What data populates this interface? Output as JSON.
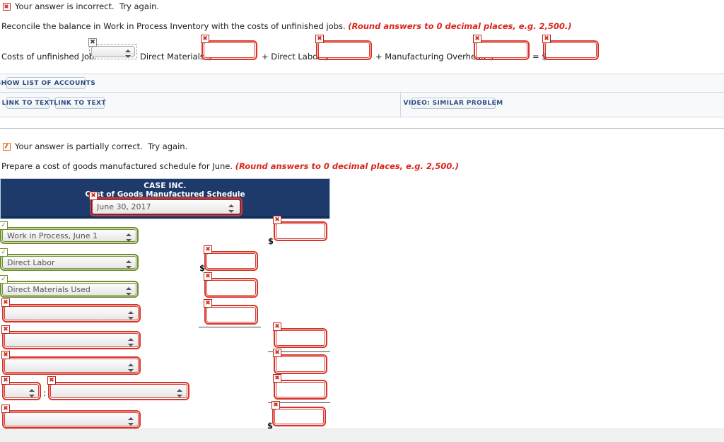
{
  "part1": {
    "status": {
      "icon": "error-x-icon",
      "text": "Your answer is incorrect.  Try again."
    },
    "prompt_main": "Reconcile the balance in Work in Process Inventory with the costs of unfinished jobs. ",
    "prompt_hint": "(Round answers to 0 decimal places, e.g. 2,500.)",
    "label_job": "Costs of unfinished Job:",
    "job_select_value": "",
    "label_dm": "Direct Materials $",
    "label_dl": "+ Direct Labor $",
    "label_moh": "+ Manufacturing Overhead $",
    "label_eq": "= $",
    "dm_value": "",
    "dl_value": "",
    "moh_value": "",
    "total_value": ""
  },
  "toolbar": {
    "show_list_of_accounts": "SHOW LIST OF ACCOUNTS",
    "link_to_text_1": "LINK TO TEXT",
    "link_to_text_2": "LINK TO TEXT",
    "video_similar_problem": "VIDEO: SIMILAR PROBLEM"
  },
  "part2": {
    "status": {
      "icon": "partial-credit-icon",
      "text": "Your answer is partially correct.  Try again."
    },
    "prompt_main": "Prepare a cost of goods manufactured schedule for June. ",
    "prompt_hint": "(Round answers to 0 decimal places, e.g. 2,500.)",
    "header": {
      "company": "CASE INC.",
      "title": "Cost of Goods Manufactured Schedule",
      "date_select_value": "June 30, 2017"
    },
    "rows": [
      {
        "label_value": "Work in Process, June 1",
        "label_state": "ok",
        "amount_col": "right",
        "amount_value": "",
        "dollar": true,
        "rule": "none"
      },
      {
        "label_value": "Direct Labor",
        "label_state": "ok",
        "amount_col": "mid",
        "amount_value": "",
        "dollar": true,
        "rule": "none"
      },
      {
        "label_value": "Direct Materials Used",
        "label_state": "ok",
        "amount_col": "mid",
        "amount_value": "",
        "dollar": false,
        "rule": "none"
      },
      {
        "label_value": "",
        "label_state": "error",
        "amount_col": "mid",
        "amount_value": "",
        "dollar": false,
        "rule": "single"
      },
      {
        "label_value": "",
        "label_state": "error",
        "amount_col": "right",
        "amount_value": "",
        "dollar": false,
        "rule": "single"
      },
      {
        "label_value": "",
        "label_state": "error",
        "amount_col": "right",
        "amount_value": "",
        "dollar": false,
        "rule": "none"
      },
      {
        "label_value": "",
        "label_state": "error",
        "amount_col": "right",
        "amount_value": "",
        "dollar": false,
        "rule": "single"
      },
      {
        "label_value": "",
        "label_state": "error",
        "amount_col": "right",
        "amount_value": "",
        "dollar": true,
        "rule": "double"
      }
    ],
    "split_row": {
      "small_select_value": "",
      "separator": ":",
      "wide_select_value": ""
    }
  },
  "colors": {
    "error": "#d8352a",
    "ok": "#6f8f2f",
    "header_navy": "#1d3a6b",
    "hint_red": "#d9261c",
    "button_text": "#2d4b80"
  }
}
